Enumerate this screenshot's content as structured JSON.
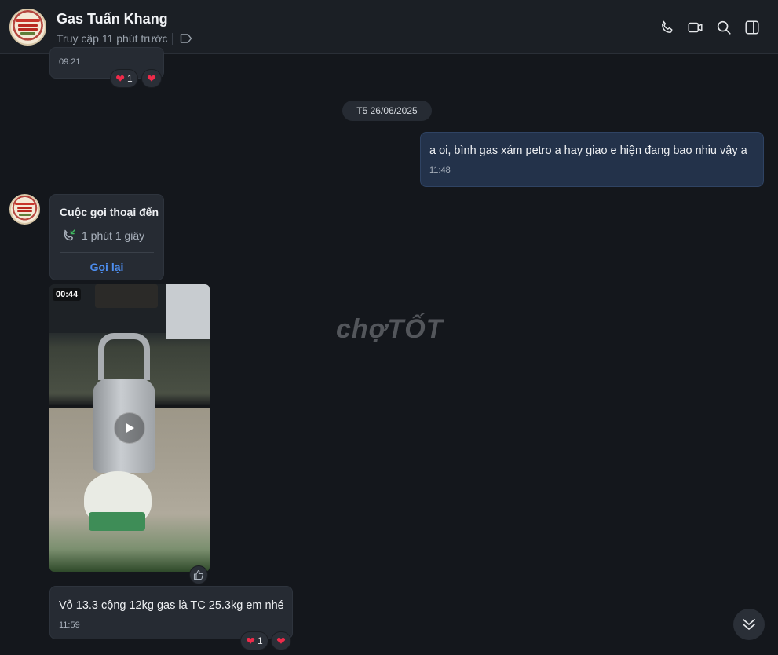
{
  "header": {
    "title": "Gas Tuấn Khang",
    "status": "Truy cập 11 phút trước",
    "icons": [
      "phone-icon",
      "video-call-icon",
      "search-icon",
      "sidebar-toggle-icon",
      "tag-icon"
    ]
  },
  "messages": {
    "prev": {
      "time": "09:21",
      "reaction_count": "1"
    },
    "date_separator": "T5 26/06/2025",
    "outgoing": {
      "text": "a oi, bình gas xám petro a hay giao e hiện đang bao nhiu vậy a",
      "time": "11:48"
    },
    "call": {
      "title": "Cuộc gọi thoại đến",
      "duration": "1 phút 1 giây",
      "callback_label": "Gọi lại"
    },
    "video": {
      "duration": "00:44"
    },
    "reply": {
      "text": "Vỏ 13.3 cộng 12kg gas là TC 25.3kg em nhé",
      "time": "11:59",
      "reaction_count": "1"
    }
  },
  "watermark": "chợTỐT",
  "colors": {
    "accent": "#4d8ef0",
    "heart": "#ef2b4a",
    "outgoing_bubble": "#23324a"
  }
}
